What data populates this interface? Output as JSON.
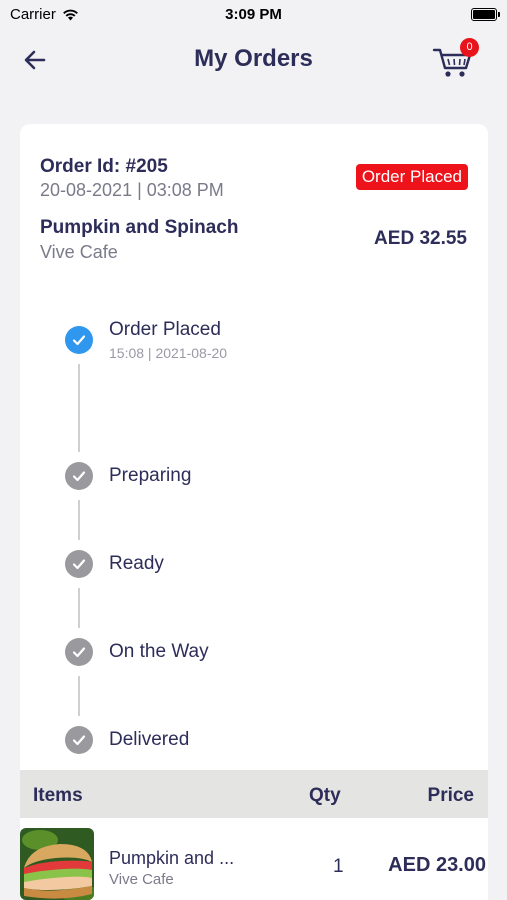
{
  "status_bar": {
    "carrier": "Carrier",
    "time": "3:09 PM",
    "battery_level": 1.0
  },
  "nav": {
    "title": "My Orders",
    "cart_count": "0",
    "back_icon": "arrow-left-icon",
    "cart_icon": "shopping-cart-icon"
  },
  "order": {
    "id_label": "Order Id: #205",
    "datetime": "20-08-2021 | 03:08 PM",
    "status": "Order Placed",
    "item_name": "Pumpkin and Spinach",
    "cafe": "Vive Cafe",
    "total": "AED 32.55",
    "status_color": "#ee121b"
  },
  "timeline": [
    {
      "label": "Order Placed",
      "time": "15:08 | 2021-08-20",
      "state": "active"
    },
    {
      "label": "Preparing",
      "time": "",
      "state": "done"
    },
    {
      "label": "Ready",
      "time": "",
      "state": "done"
    },
    {
      "label": "On the Way",
      "time": "",
      "state": "done"
    },
    {
      "label": "Delivered",
      "time": "",
      "state": "done"
    }
  ],
  "table": {
    "headers": {
      "items": "Items",
      "qty": "Qty",
      "price": "Price"
    },
    "rows": [
      {
        "name": "Pumpkin and ...",
        "cafe": "Vive Cafe",
        "qty": "1",
        "price": "AED 23.00"
      }
    ]
  },
  "colors": {
    "primary_text": "#2d2d5a",
    "active_step": "#2f98ee",
    "inactive_step": "#9a9a9e"
  }
}
